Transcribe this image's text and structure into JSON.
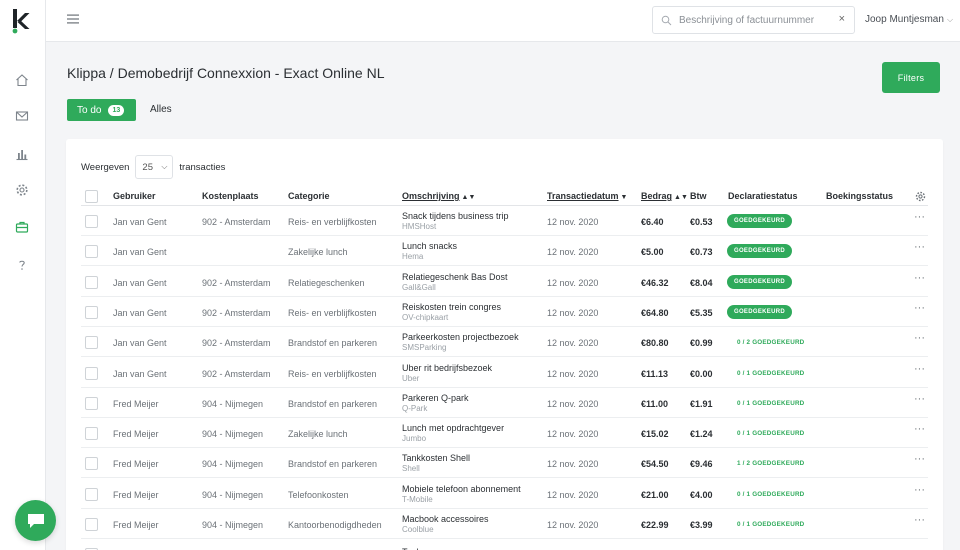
{
  "app": {
    "search_placeholder": "Beschrijving of factuurnummer",
    "search_clear": "×",
    "user_name": "Joop Muntjesman",
    "user_chevron": "⌵"
  },
  "sidebar": {
    "icons": [
      "home-icon",
      "mail-icon",
      "chart-icon",
      "gear-icon",
      "briefcase-icon",
      "help-icon"
    ],
    "active": "briefcase-icon",
    "accent": "#2faa5b"
  },
  "page": {
    "title": "Klippa / Demobedrijf Connexxion - Exact Online NL",
    "filters_label": "Filters",
    "tabs": [
      {
        "label": "To do",
        "count": "13"
      },
      {
        "label": "Alles"
      }
    ],
    "per_page_prefix": "Weergeven",
    "per_page_value": "25",
    "per_page_suffix": "transacties"
  },
  "table": {
    "columns": [
      "Gebruiker",
      "Kostenplaats",
      "Categorie",
      "Omschrijving",
      "Transactiedatum",
      "Bedrag",
      "Btw",
      "Declaratiestatus",
      "Boekingsstatus"
    ],
    "rows": [
      {
        "user": "Jan van Gent",
        "cost_center": "902 - Amsterdam",
        "category": "Reis- en verblijfkosten",
        "desc": "Snack tijdens business trip",
        "vendor": "HMSHost",
        "date": "12 nov. 2020",
        "amount": "€6.40",
        "vat": "€0.53",
        "status": "GOEDGEKEURD",
        "status_type": "pill"
      },
      {
        "user": "Jan van Gent",
        "cost_center": "",
        "category": "Zakelijke lunch",
        "desc": "Lunch snacks",
        "vendor": "Hema",
        "date": "12 nov. 2020",
        "amount": "€5.00",
        "vat": "€0.73",
        "status": "GOEDGEKEURD",
        "status_type": "pill"
      },
      {
        "user": "Jan van Gent",
        "cost_center": "902 - Amsterdam",
        "category": "Relatiegeschenken",
        "desc": "Relatiegeschenk Bas Dost",
        "vendor": "Gall&Gall",
        "date": "12 nov. 2020",
        "amount": "€46.32",
        "vat": "€8.04",
        "status": "GOEDGEKEURD",
        "status_type": "pill"
      },
      {
        "user": "Jan van Gent",
        "cost_center": "902 - Amsterdam",
        "category": "Reis- en verblijfkosten",
        "desc": "Reiskosten trein congres",
        "vendor": "OV-chipkaart",
        "date": "12 nov. 2020",
        "amount": "€64.80",
        "vat": "€5.35",
        "status": "GOEDGEKEURD",
        "status_type": "pill"
      },
      {
        "user": "Jan van Gent",
        "cost_center": "902 - Amsterdam",
        "category": "Brandstof en parkeren",
        "desc": "Parkeerkosten projectbezoek",
        "vendor": "SMSParking",
        "date": "12 nov. 2020",
        "amount": "€80.80",
        "vat": "€0.99",
        "status": "0 / 2 GOEDGEKEURD",
        "status_type": "text"
      },
      {
        "user": "Jan van Gent",
        "cost_center": "902 - Amsterdam",
        "category": "Reis- en verblijfkosten",
        "desc": "Uber rit bedrijfsbezoek",
        "vendor": "Uber",
        "date": "12 nov. 2020",
        "amount": "€11.13",
        "vat": "€0.00",
        "status": "0 / 1 GOEDGEKEURD",
        "status_type": "text"
      },
      {
        "user": "Fred Meijer",
        "cost_center": "904 - Nijmegen",
        "category": "Brandstof en parkeren",
        "desc": "Parkeren Q-park",
        "vendor": "Q-Park",
        "date": "12 nov. 2020",
        "amount": "€11.00",
        "vat": "€1.91",
        "status": "0 / 1 GOEDGEKEURD",
        "status_type": "text"
      },
      {
        "user": "Fred Meijer",
        "cost_center": "904 - Nijmegen",
        "category": "Zakelijke lunch",
        "desc": "Lunch met opdrachtgever",
        "vendor": "Jumbo",
        "date": "12 nov. 2020",
        "amount": "€15.02",
        "vat": "€1.24",
        "status": "0 / 1 GOEDGEKEURD",
        "status_type": "text"
      },
      {
        "user": "Fred Meijer",
        "cost_center": "904 - Nijmegen",
        "category": "Brandstof en parkeren",
        "desc": "Tankkosten Shell",
        "vendor": "Shell",
        "date": "12 nov. 2020",
        "amount": "€54.50",
        "vat": "€9.46",
        "status": "1 / 2 GOEDGEKEURD",
        "status_type": "text"
      },
      {
        "user": "Fred Meijer",
        "cost_center": "904 - Nijmegen",
        "category": "Telefoonkosten",
        "desc": "Mobiele telefoon abonnement",
        "vendor": "T-Mobile",
        "date": "12 nov. 2020",
        "amount": "€21.00",
        "vat": "€4.00",
        "status": "0 / 1 GOEDGEKEURD",
        "status_type": "text"
      },
      {
        "user": "Fred Meijer",
        "cost_center": "904 - Nijmegen",
        "category": "Kantoorbenodigdheden",
        "desc": "Macbook accessoires",
        "vendor": "Coolblue",
        "date": "12 nov. 2020",
        "amount": "€22.99",
        "vat": "€3.99",
        "status": "0 / 1 GOEDGEKEURD",
        "status_type": "text"
      },
      {
        "user": "",
        "cost_center": "",
        "category": "",
        "desc": "Tanken",
        "vendor": "",
        "date": "",
        "amount": "",
        "vat": "",
        "status": "",
        "status_type": "none"
      }
    ],
    "row_menu": "···"
  }
}
